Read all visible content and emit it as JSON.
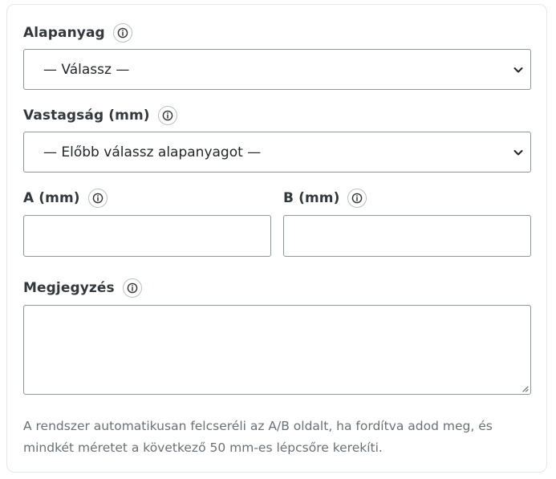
{
  "form": {
    "material": {
      "label": "Alapanyag",
      "selected": "— Válassz —"
    },
    "thickness": {
      "label": "Vastagság (mm)",
      "selected": "— Előbb válassz alapanyagot —"
    },
    "dim_a": {
      "label": "A (mm)",
      "value": ""
    },
    "dim_b": {
      "label": "B (mm)",
      "value": ""
    },
    "comment": {
      "label": "Megjegyzés",
      "value": ""
    },
    "help_text": "A rendszer automatikusan felcseréli az A/B oldalt, ha fordítva adod meg, és mindkét méretet a következő 50 mm-es lépcsőre kerekíti."
  },
  "icons": {
    "info": "info-icon",
    "dropdown": "chevron-down-icon",
    "resize": "resize-grip-icon"
  },
  "colors": {
    "border": "#8f959b",
    "label": "#33383d",
    "help_text": "#6a7077"
  }
}
